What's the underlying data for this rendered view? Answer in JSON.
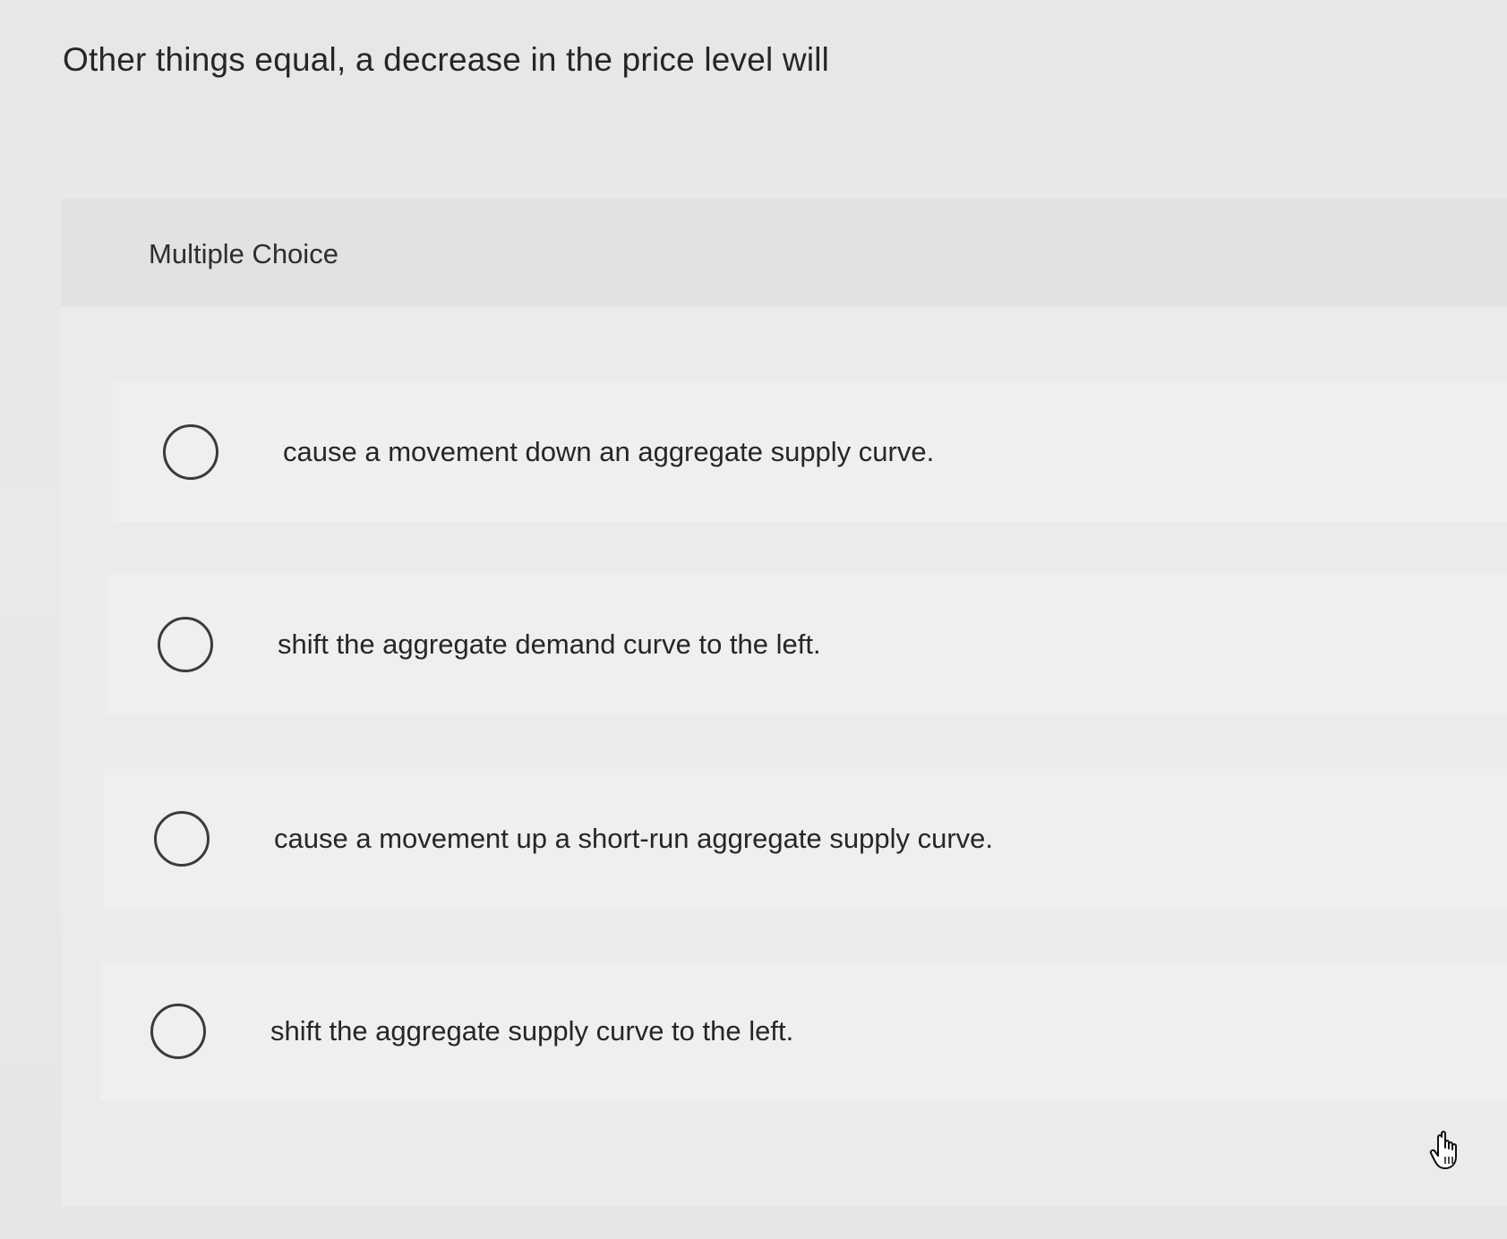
{
  "question": {
    "text": "Other things equal, a decrease in the price level will"
  },
  "panel": {
    "label": "Multiple Choice"
  },
  "options": [
    {
      "text": "cause a movement down an aggregate supply curve.",
      "selected": false
    },
    {
      "text": "shift the aggregate demand curve to the left.",
      "selected": false
    },
    {
      "text": "cause a movement up a short-run aggregate supply curve.",
      "selected": false
    },
    {
      "text": "shift the aggregate supply curve to the left.",
      "selected": false
    }
  ],
  "icons": {
    "radio": "radio-unselected-icon",
    "cursor": "hand-pointer-icon"
  }
}
